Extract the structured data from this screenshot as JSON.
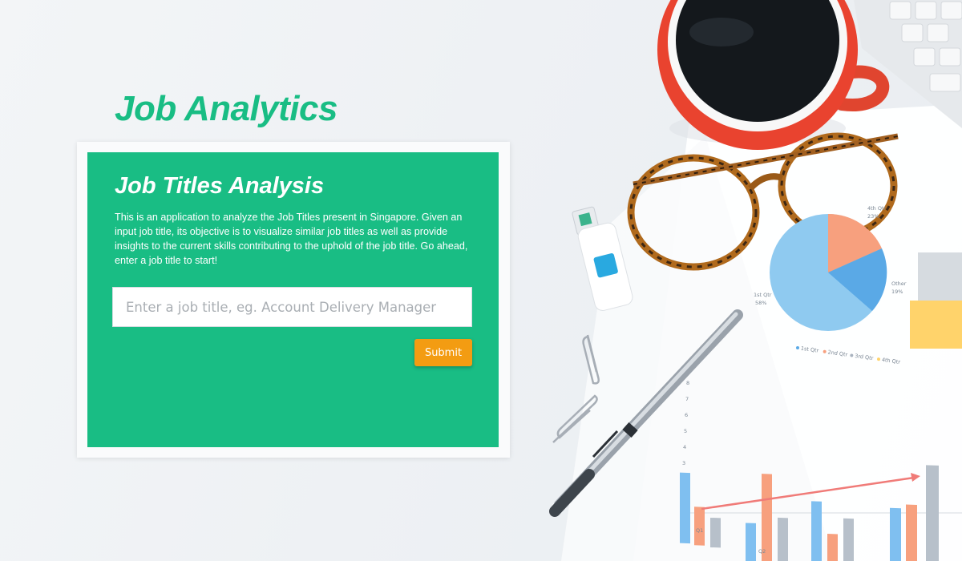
{
  "app": {
    "title": "Job Analytics"
  },
  "card": {
    "heading": "Job Titles Analysis",
    "description": "This is an application to analyze the Job Titles present in Singapore. Given an input job title, its objective is to visualize similar job titles as well as provide insights to the current skills contributing to the uphold of the job title. Go ahead, enter a job title to start!"
  },
  "search": {
    "value": "",
    "placeholder": "Enter a job title, eg. Account Delivery Manager"
  },
  "actions": {
    "submit_label": "Submit"
  },
  "colors": {
    "brand_green": "#19bd84",
    "card_green": "#19bd84",
    "submit_orange": "#f39c12"
  },
  "background_illustration": {
    "pie_labels": [
      "Other\n19%",
      "1st Qtr\n58%",
      "4th Qtr\n23%"
    ],
    "legend": [
      "1st Qtr",
      "2nd Qtr",
      "3rd Qtr",
      "4th Qtr"
    ],
    "bar_axis_ticks": [
      "0",
      "1",
      "2",
      "3",
      "4",
      "5",
      "6",
      "7",
      "8"
    ],
    "bar_categories": [
      "Q1",
      "Q2"
    ]
  }
}
